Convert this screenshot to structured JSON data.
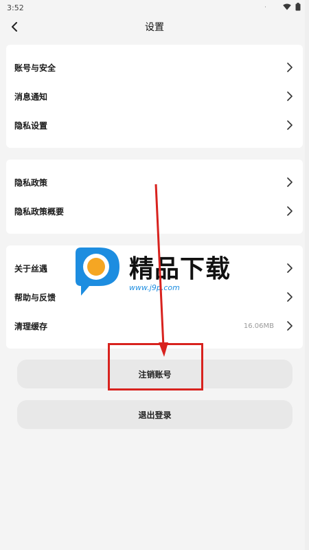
{
  "status_bar": {
    "time": "3:52",
    "dot": "·"
  },
  "header": {
    "title": "设置"
  },
  "cards": [
    {
      "items": [
        {
          "label": "账号与安全"
        },
        {
          "label": "消息通知"
        },
        {
          "label": "隐私设置"
        }
      ]
    },
    {
      "items": [
        {
          "label": "隐私政策"
        },
        {
          "label": "隐私政策概要"
        }
      ]
    },
    {
      "items": [
        {
          "label": "关于丝遇"
        },
        {
          "label": "帮助与反馈"
        },
        {
          "label": "清理缓存",
          "value": "16.06MB"
        }
      ]
    }
  ],
  "buttons": {
    "deactivate_label": "注销账号",
    "logout_label": "退出登录"
  },
  "watermark": {
    "title": "精品下载",
    "url": "www.j9p.com"
  },
  "colors": {
    "background": "#f4f4f4",
    "card": "#ffffff",
    "button": "#e8e8e8",
    "annotation_red": "#d8221e",
    "watermark_blue": "#1d8de0",
    "watermark_orange": "#f5a623"
  }
}
